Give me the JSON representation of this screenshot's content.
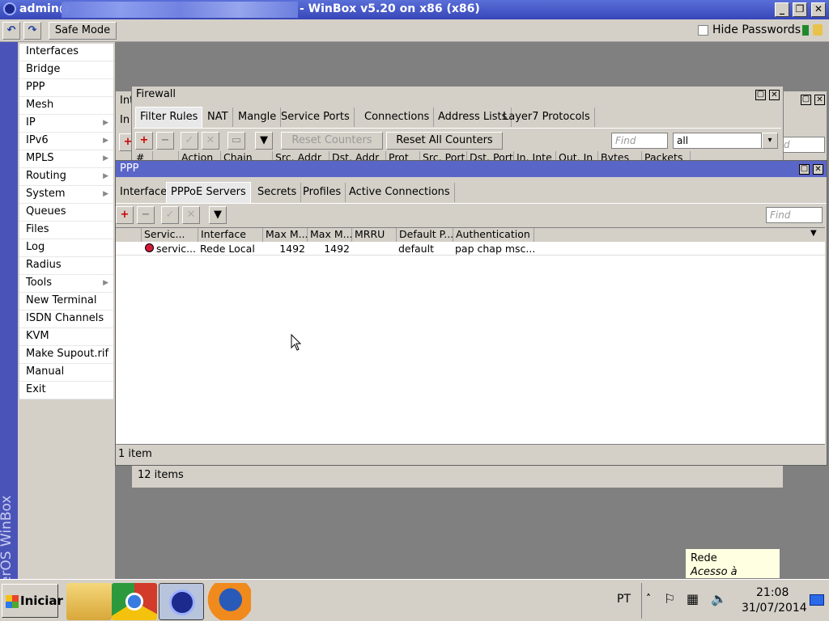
{
  "window": {
    "title_prefix": "admin@",
    "title_suffix": "- WinBox v5.20 on x86 (x86)"
  },
  "toolbar": {
    "undo": "↶",
    "redo": "↷",
    "safe_mode": "Safe Mode",
    "hide_passwords": "Hide Passwords"
  },
  "sidebar": {
    "brand": "RouterOS WinBox",
    "items": [
      {
        "label": "Interfaces",
        "sub": false
      },
      {
        "label": "Bridge",
        "sub": false
      },
      {
        "label": "PPP",
        "sub": false
      },
      {
        "label": "Mesh",
        "sub": false
      },
      {
        "label": "IP",
        "sub": true
      },
      {
        "label": "IPv6",
        "sub": true
      },
      {
        "label": "MPLS",
        "sub": true
      },
      {
        "label": "Routing",
        "sub": true
      },
      {
        "label": "System",
        "sub": true
      },
      {
        "label": "Queues",
        "sub": false
      },
      {
        "label": "Files",
        "sub": false
      },
      {
        "label": "Log",
        "sub": false
      },
      {
        "label": "Radius",
        "sub": false
      },
      {
        "label": "Tools",
        "sub": true
      },
      {
        "label": "New Terminal",
        "sub": false
      },
      {
        "label": "ISDN Channels",
        "sub": false
      },
      {
        "label": "KVM",
        "sub": false
      },
      {
        "label": "Make Supout.rif",
        "sub": false
      },
      {
        "label": "Manual",
        "sub": false
      },
      {
        "label": "Exit",
        "sub": false
      }
    ]
  },
  "interfaces_window": {
    "title": "Int",
    "tab": "In",
    "find": "d"
  },
  "firewall": {
    "title": "Firewall",
    "tabs": [
      "Filter Rules",
      "NAT",
      "Mangle",
      "Service Ports",
      "Connections",
      "Address Lists",
      "Layer7 Protocols"
    ],
    "reset_counters": "Reset Counters",
    "reset_all_counters": "Reset All Counters",
    "find_placeholder": "Find",
    "filter_value": "all",
    "columns": [
      "#",
      "",
      "Action",
      "Chain",
      "Src. Addr",
      "Dst. Addr",
      "Prot",
      "Src. Port",
      "Dst. Port",
      "In. Inte",
      "Out. In",
      "Bytes",
      "Packets"
    ],
    "status": "12 items"
  },
  "ppp": {
    "title": "PPP",
    "tabs": [
      "Interface",
      "PPPoE Servers",
      "Secrets",
      "Profiles",
      "Active Connections"
    ],
    "find_placeholder": "Find",
    "columns": [
      "Servic...",
      "Interface",
      "Max M...",
      "Max M...",
      "MRRU",
      "Default P...",
      "Authentication"
    ],
    "rows": [
      {
        "service": "servic...",
        "interface": "Rede Local",
        "max_mtu": "1492",
        "max_mru": "1492",
        "mrru": "",
        "default_profile": "default",
        "authentication": "pap chap msc..."
      }
    ],
    "status": "1 item"
  },
  "tooltip": {
    "title": "Rede",
    "text": "Acesso à Internet"
  },
  "taskbar": {
    "start": "Iniciar",
    "lang": "PT",
    "time": "21:08",
    "date": "31/07/2014"
  }
}
